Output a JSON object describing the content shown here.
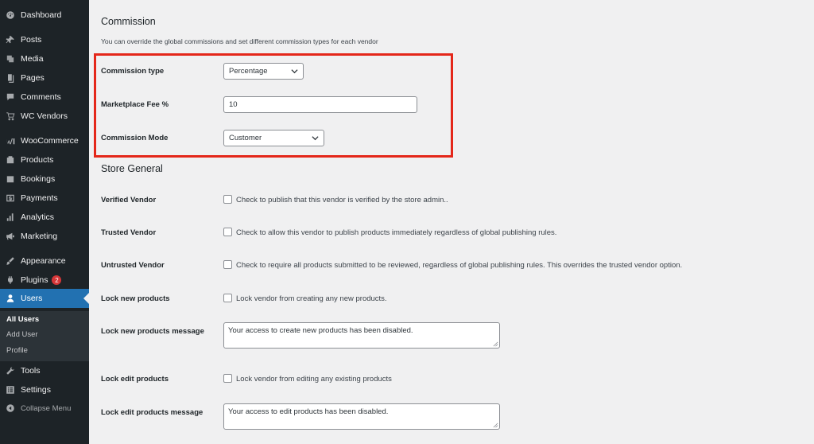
{
  "sidebar": {
    "items": [
      {
        "label": "Dashboard",
        "icon": "dashboard-icon"
      },
      {
        "label": "Posts",
        "icon": "pin-icon"
      },
      {
        "label": "Media",
        "icon": "media-icon"
      },
      {
        "label": "Pages",
        "icon": "pages-icon"
      },
      {
        "label": "Comments",
        "icon": "comments-icon"
      },
      {
        "label": "WC Vendors",
        "icon": "cart-icon"
      },
      {
        "label": "WooCommerce",
        "icon": "woo-icon"
      },
      {
        "label": "Products",
        "icon": "products-icon"
      },
      {
        "label": "Bookings",
        "icon": "calendar-icon"
      },
      {
        "label": "Payments",
        "icon": "dollar-icon"
      },
      {
        "label": "Analytics",
        "icon": "chart-icon"
      },
      {
        "label": "Marketing",
        "icon": "megaphone-icon"
      },
      {
        "label": "Appearance",
        "icon": "brush-icon"
      },
      {
        "label": "Plugins",
        "icon": "plug-icon",
        "badge": "2"
      },
      {
        "label": "Users",
        "icon": "user-icon"
      },
      {
        "label": "Tools",
        "icon": "wrench-icon"
      },
      {
        "label": "Settings",
        "icon": "settings-icon"
      }
    ],
    "submenu": [
      "All Users",
      "Add User",
      "Profile"
    ],
    "collapse_label": "Collapse Menu",
    "active_color": "#2271b1"
  },
  "commission": {
    "title": "Commission",
    "description": "You can override the global commissions and set different commission types for each vendor",
    "type_label": "Commission type",
    "type_value": "Percentage",
    "fee_label": "Marketplace Fee %",
    "fee_value": "10",
    "mode_label": "Commission Mode",
    "mode_value": "Customer",
    "highlight_color": "#e4271a"
  },
  "store_general": {
    "title": "Store General",
    "verified_label": "Verified Vendor",
    "verified_text": "Check to publish that this vendor is verified by the store admin..",
    "trusted_label": "Trusted Vendor",
    "trusted_text": "Check to allow this vendor to publish products immediately regardless of global publishing rules.",
    "untrusted_label": "Untrusted Vendor",
    "untrusted_text": "Check to require all products submitted to be reviewed, regardless of global publishing rules. This overrides the trusted vendor option.",
    "lock_new_label": "Lock new products",
    "lock_new_text": "Lock vendor from creating any new products.",
    "lock_new_msg_label": "Lock new products message",
    "lock_new_msg_value": "Your access to create new products has been disabled.",
    "lock_edit_label": "Lock edit products",
    "lock_edit_text": "Lock vendor from editing any existing products",
    "lock_edit_msg_label": "Lock edit products message",
    "lock_edit_msg_value": "Your access to edit products has been disabled."
  }
}
